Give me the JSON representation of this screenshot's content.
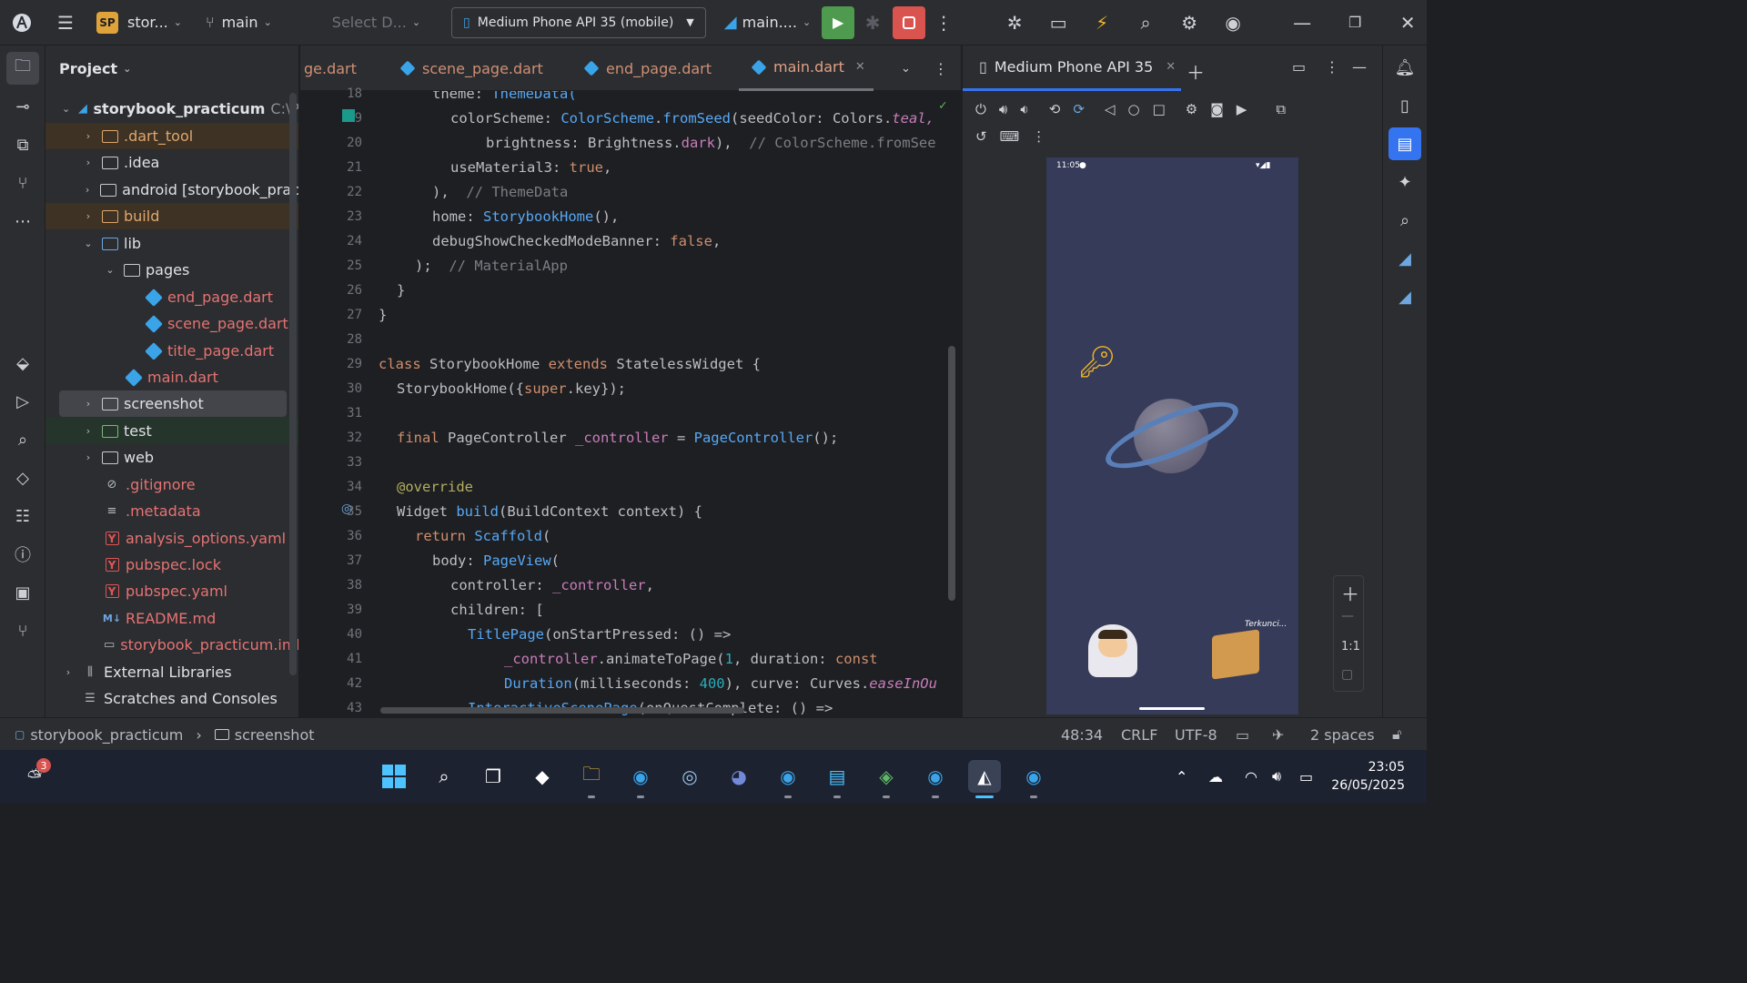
{
  "titlebar": {
    "project_badge": "SP",
    "project_name": "stor...",
    "branch": "main",
    "select_device": "Select D...",
    "device": "Medium Phone API 35 (mobile)",
    "run_config": "main...."
  },
  "project_panel": {
    "title": "Project",
    "items": [
      {
        "label": "storybook_practicum",
        "suffix": "C:\\P"
      },
      {
        "label": ".dart_tool"
      },
      {
        "label": ".idea"
      },
      {
        "label": "android [storybook_prac"
      },
      {
        "label": "build"
      },
      {
        "label": "lib"
      },
      {
        "label": "pages"
      },
      {
        "label": "end_page.dart"
      },
      {
        "label": "scene_page.dart"
      },
      {
        "label": "title_page.dart"
      },
      {
        "label": "main.dart"
      },
      {
        "label": "screenshot"
      },
      {
        "label": "test"
      },
      {
        "label": "web"
      },
      {
        "label": ".gitignore"
      },
      {
        "label": ".metadata"
      },
      {
        "label": "analysis_options.yaml"
      },
      {
        "label": "pubspec.lock"
      },
      {
        "label": "pubspec.yaml"
      },
      {
        "label": "README.md",
        "badge": "M↓"
      },
      {
        "label": "storybook_practicum.iml"
      },
      {
        "label": "External Libraries"
      },
      {
        "label": "Scratches and Consoles"
      }
    ]
  },
  "editor": {
    "tabs": [
      {
        "label": "ge.dart"
      },
      {
        "label": "scene_page.dart"
      },
      {
        "label": "end_page.dart"
      },
      {
        "label": "main.dart"
      }
    ],
    "line_numbers": [
      "18",
      "19",
      "20",
      "21",
      "22",
      "23",
      "24",
      "25",
      "26",
      "27",
      "28",
      "29",
      "30",
      "31",
      "32",
      "33",
      "34",
      "35",
      "36",
      "37",
      "38",
      "39",
      "40",
      "41",
      "42",
      "43"
    ],
    "code": {
      "l18a": "theme: ",
      "l18b": "ThemeData(",
      "l19a": "colorScheme: ",
      "l19b": "ColorScheme",
      "l19c": ".",
      "l19d": "fromSeed",
      "l19e": "(seedColor: Colors.",
      "l19f": "teal,",
      "l20a": "brightness: Brightness.",
      "l20b": "dark",
      "l20c": "),  ",
      "l20d": "// ColorScheme.fromSee",
      "l21a": "useMaterial3: ",
      "l21b": "true",
      "l21c": ",",
      "l22a": "),  ",
      "l22b": "// ThemeData",
      "l23a": "home: ",
      "l23b": "StorybookHome",
      "l23c": "(),",
      "l24a": "debugShowCheckedModeBanner: ",
      "l24b": "false",
      "l24c": ",",
      "l25a": ");  ",
      "l25b": "// MaterialApp",
      "l26": "}",
      "l27": "}",
      "l29a": "class ",
      "l29b": "StorybookHome ",
      "l29c": "extends ",
      "l29d": "StatelessWidget {",
      "l30a": "StorybookHome({",
      "l30b": "super",
      "l30c": ".key});",
      "l32a": "final ",
      "l32b": "PageController ",
      "l32c": "_controller",
      "l32d": " = ",
      "l32e": "PageController",
      "l32f": "();",
      "l34": "@override",
      "l35a": "Widget ",
      "l35b": "build",
      "l35c": "(BuildContext context) {",
      "l36a": "return ",
      "l36b": "Scaffold",
      "l36c": "(",
      "l37a": "body: ",
      "l37b": "PageView",
      "l37c": "(",
      "l38a": "controller: ",
      "l38b": "_controller",
      "l38c": ",",
      "l39": "children: [",
      "l40a": "TitlePage",
      "l40b": "(onStartPressed: () =>",
      "l41a": "_controller",
      "l41b": ".animateToPage(",
      "l41c": "1",
      "l41d": ", duration: ",
      "l41e": "const",
      "l42a": "Duration",
      "l42b": "(milliseconds: ",
      "l42c": "400",
      "l42d": "), curve: Curves.",
      "l42e": "easeInOu",
      "l43a": "InteractiveScenePage",
      "l43b": "(onQuestComplete: () =>"
    }
  },
  "devices_panel": {
    "tab_label": "Medium Phone API 35",
    "phone": {
      "time": "11:05",
      "box_label": "Terkunci..."
    },
    "zoom_label": "1:1"
  },
  "statusbar": {
    "project": "storybook_practicum",
    "folder": "screenshot",
    "position": "48:34",
    "line_sep": "CRLF",
    "encoding": "UTF-8",
    "indent": "2 spaces"
  },
  "taskbar": {
    "weather_badge": "3",
    "time": "23:05",
    "date": "26/05/2025"
  },
  "colors": {
    "accent": "#3574f0",
    "run": "#4e9a4e",
    "stop": "#d9534f"
  }
}
